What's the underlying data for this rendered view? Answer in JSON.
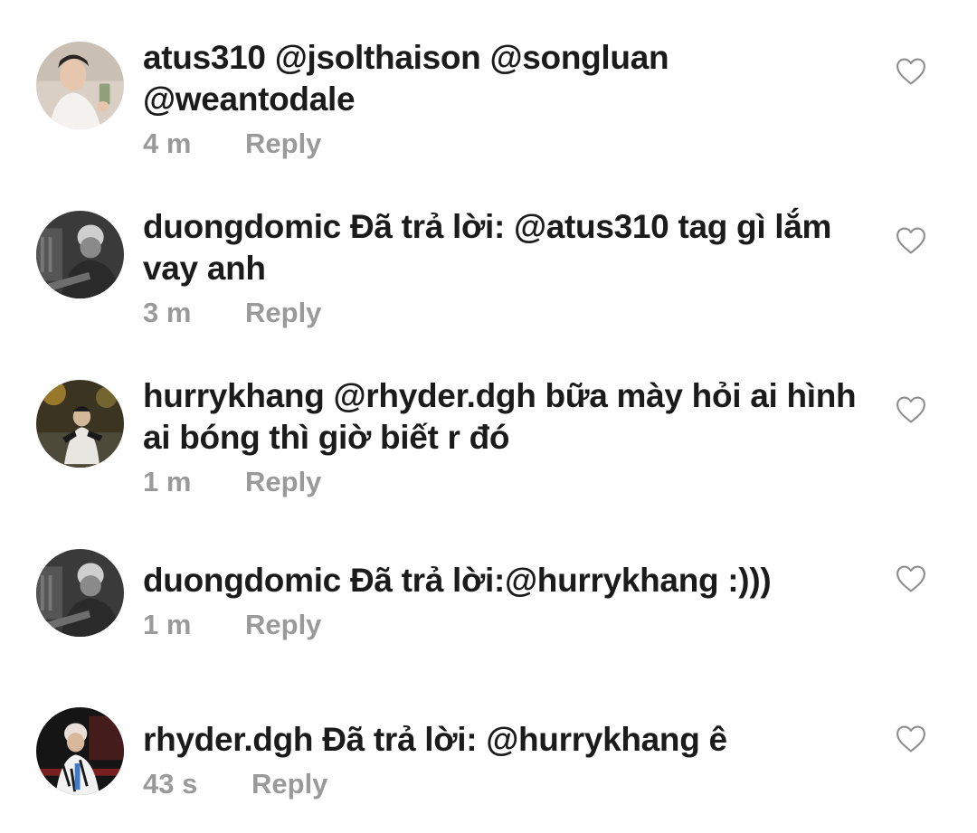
{
  "comments": [
    {
      "username": "atus310",
      "text": "@jsolthaison @songluan @weantodale",
      "time": "4 m",
      "reply_label": "Reply"
    },
    {
      "username": "duongdomic",
      "text": "Đã trả lời: @atus310 tag gì lắm vay anh",
      "time": "3 m",
      "reply_label": "Reply"
    },
    {
      "username": "hurrykhang",
      "text": "@rhyder.dgh bữa mày hỏi ai hình ai bóng thì giờ biết r đó",
      "time": "1 m",
      "reply_label": "Reply"
    },
    {
      "username": "duongdomic",
      "text": "Đã trả lời:@hurrykhang :)))",
      "time": "1 m",
      "reply_label": "Reply"
    },
    {
      "username": "rhyder.dgh",
      "text": "Đã trả lời: @hurrykhang ê",
      "time": "43 s",
      "reply_label": "Reply"
    }
  ],
  "icons": {
    "like": "heart-outline-icon"
  },
  "colors": {
    "text": "#1b1b1b",
    "meta": "#9a9a9a",
    "heart": "#8e8e8e",
    "background": "#ffffff"
  }
}
